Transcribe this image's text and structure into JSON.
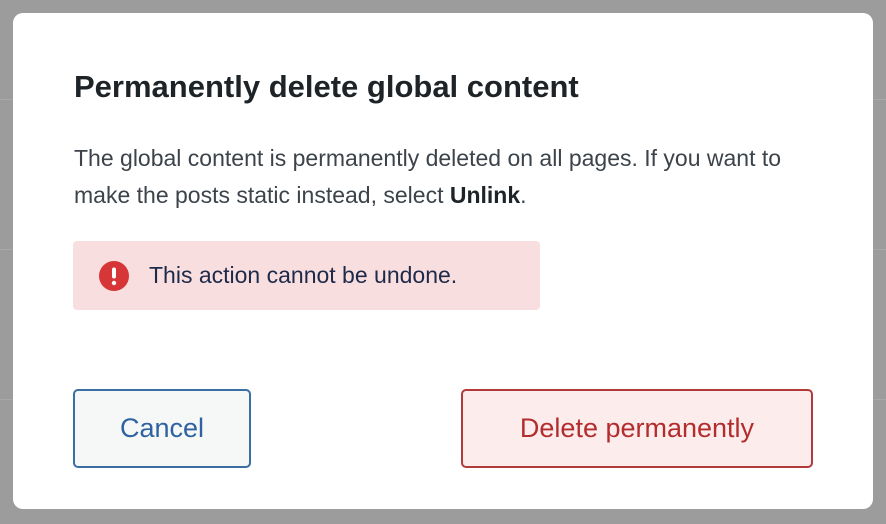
{
  "dialog": {
    "title": "Permanently delete global content",
    "body_prefix": "The global content is permanently deleted on all pages. If you want to make the posts static instead, select ",
    "body_emphasis": "Unlink",
    "body_suffix": ".",
    "notice": {
      "text": "This action cannot be undone.",
      "icon": "error-icon",
      "icon_color": "#d63638",
      "background": "#f9dedf"
    },
    "cancel_label": "Cancel",
    "delete_label": "Delete permanently"
  },
  "colors": {
    "overlay": "#9c9c9c",
    "cancel_border": "#3a6ea5",
    "delete_border": "#b33a3a",
    "delete_text": "#b32d2e"
  }
}
